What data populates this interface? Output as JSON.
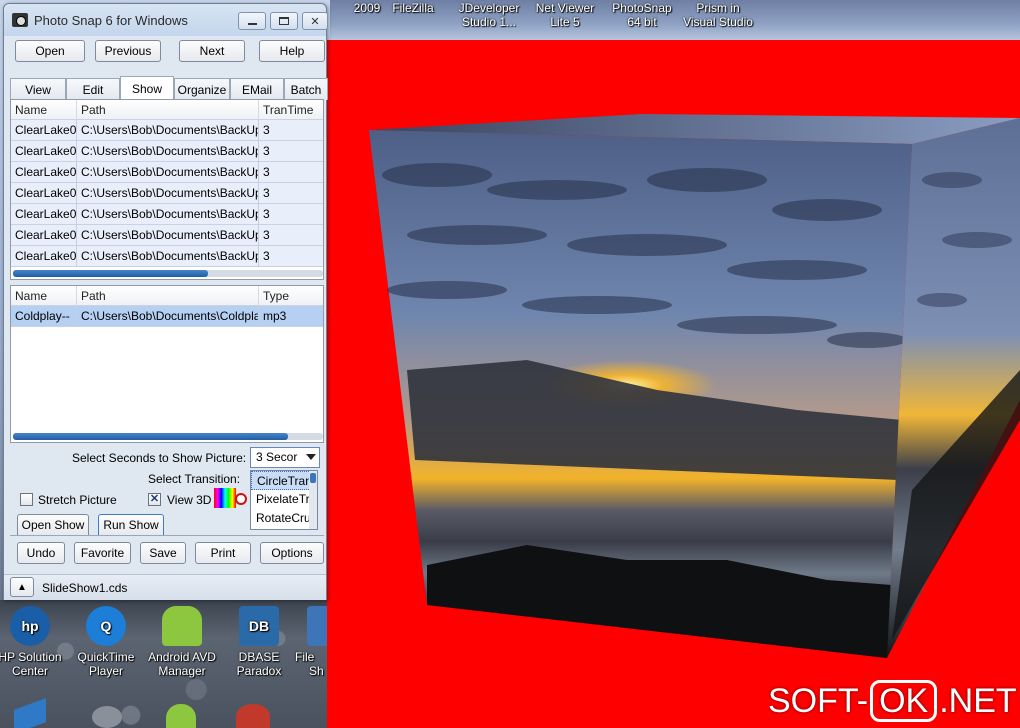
{
  "desktop": {
    "top_icons": [
      {
        "line1": "2009",
        "line2": ""
      },
      {
        "line1": "FileZilla",
        "line2": ""
      },
      {
        "line1": "JDeveloper",
        "line2": "Studio 1..."
      },
      {
        "line1": "Net Viewer",
        "line2": "Lite 5"
      },
      {
        "line1": "PhotoSnap",
        "line2": "64 bit"
      },
      {
        "line1": "Prism in",
        "line2": "Visual Studio"
      }
    ],
    "bottom_icons": [
      {
        "line1": "HP Solution",
        "line2": "Center"
      },
      {
        "line1": "QuickTime",
        "line2": "Player"
      },
      {
        "line1": "Android AVD",
        "line2": "Manager"
      },
      {
        "line1": "DBASE",
        "line2": "Paradox"
      },
      {
        "line1": "File",
        "line2": "Sh"
      }
    ],
    "hp_icon_text": "hp",
    "dbase_icon_text": "DB",
    "quicktime_icon_text": "Q"
  },
  "watermark": {
    "part1": "SOFT-",
    "part2": "OK",
    "part3": ".NET"
  },
  "window": {
    "title": "Photo Snap 6 for Windows",
    "buttons_top": {
      "open": "Open",
      "previous": "Previous",
      "next": "Next",
      "help": "Help"
    },
    "tabs": [
      "View",
      "Edit",
      "Show",
      "Organize",
      "EMail",
      "Batch"
    ],
    "active_tab": "Show",
    "pictures_grid": {
      "columns": [
        "Name",
        "Path",
        "TranTime"
      ],
      "rows": [
        [
          "ClearLake0",
          "C:\\Users\\Bob\\Documents\\BackUp",
          "3"
        ],
        [
          "ClearLake0",
          "C:\\Users\\Bob\\Documents\\BackUp",
          "3"
        ],
        [
          "ClearLake0",
          "C:\\Users\\Bob\\Documents\\BackUp",
          "3"
        ],
        [
          "ClearLake0",
          "C:\\Users\\Bob\\Documents\\BackUp",
          "3"
        ],
        [
          "ClearLake0",
          "C:\\Users\\Bob\\Documents\\BackUp",
          "3"
        ],
        [
          "ClearLake0",
          "C:\\Users\\Bob\\Documents\\BackUp",
          "3"
        ],
        [
          "ClearLake0",
          "C:\\Users\\Bob\\Documents\\BackUp",
          "3"
        ]
      ]
    },
    "music_grid": {
      "columns": [
        "Name",
        "Path",
        "Type"
      ],
      "rows": [
        [
          "Coldplay--",
          "C:\\Users\\Bob\\Documents\\Coldpla",
          "mp3"
        ]
      ]
    },
    "seconds_label": "Select Seconds to Show Picture:",
    "seconds_value": "3 Secor",
    "transition_label": "Select Transition:",
    "transitions": [
      "CircleTran",
      "PixelateTr",
      "RotateCru"
    ],
    "selected_transition": "CircleTran",
    "stretch_label": "Stretch Picture",
    "stretch_checked": false,
    "view3d_label": "View 3D",
    "view3d_checked": true,
    "check_mark": "✕",
    "buttons_mid": {
      "open_show": "Open Show",
      "run_show": "Run Show"
    },
    "buttons_bottom": {
      "undo": "Undo",
      "favorite": "Favorite",
      "save": "Save",
      "print": "Print",
      "options": "Options"
    },
    "status_file": "SlideShow1.cds",
    "up_arrow": "▲"
  },
  "colors": {
    "stage": "#ff0000",
    "selection_blue": "#b5d0f2",
    "scroll_blue": "#1f5fa7"
  }
}
